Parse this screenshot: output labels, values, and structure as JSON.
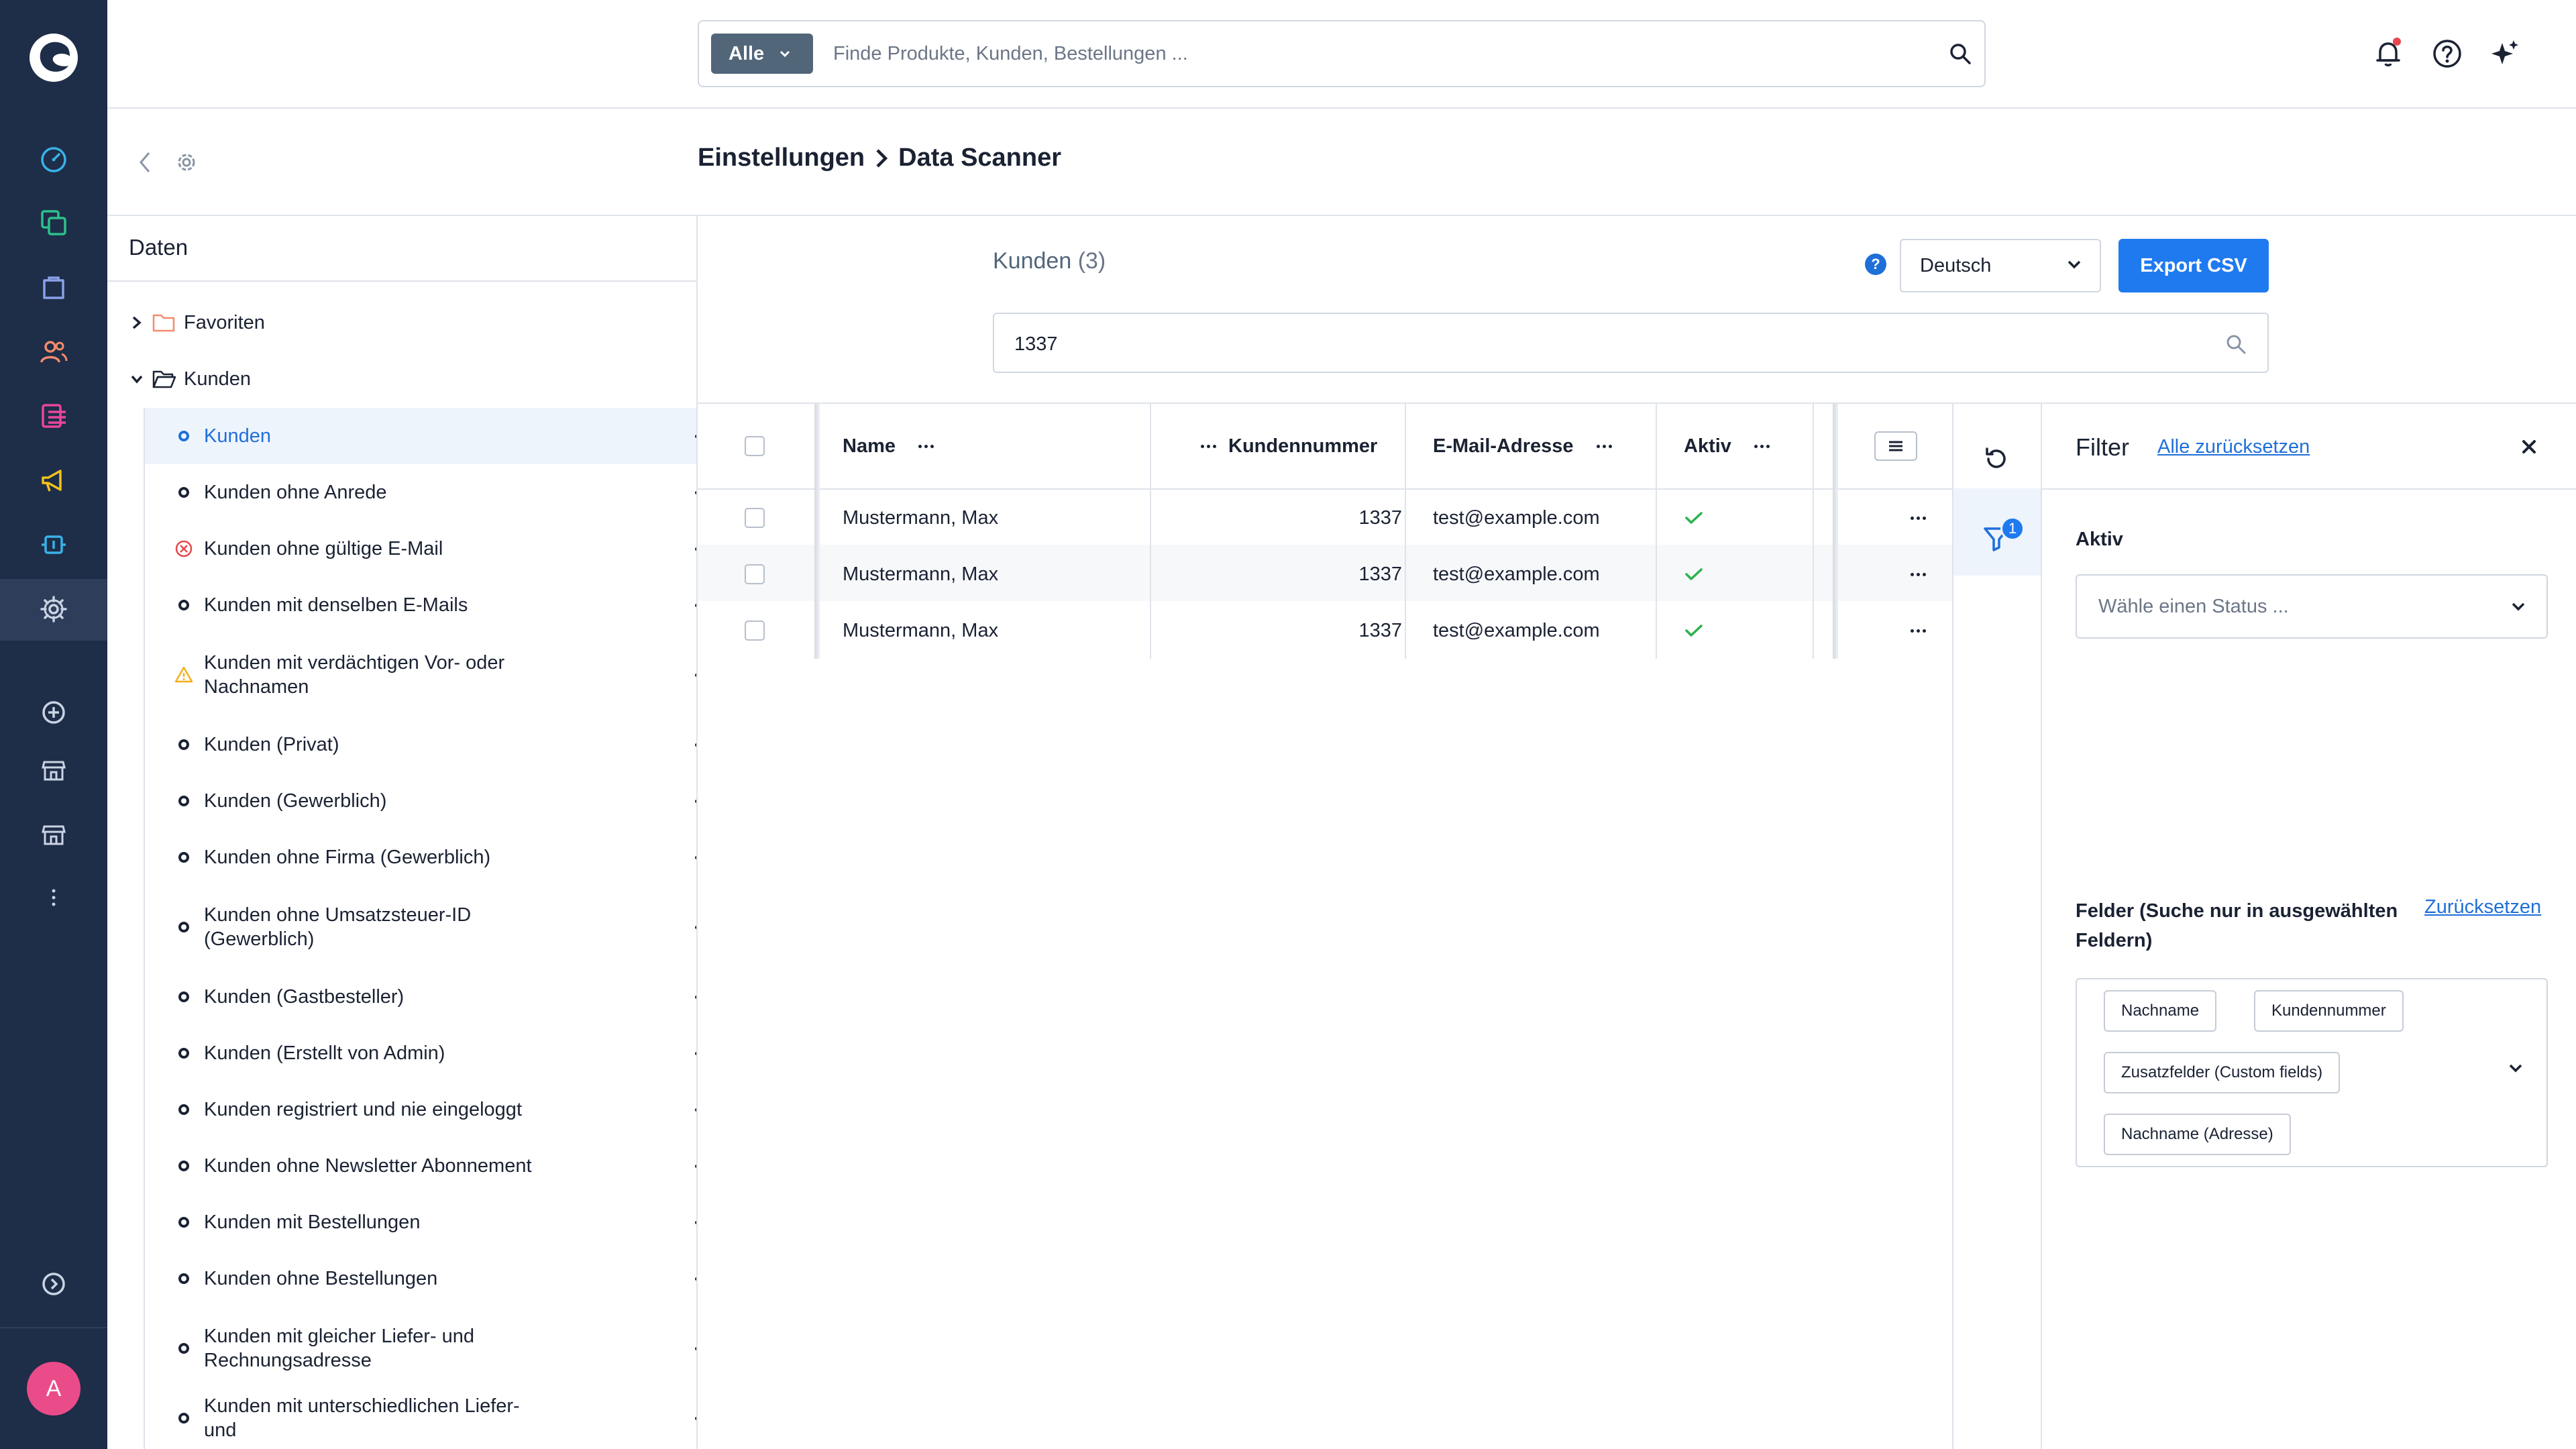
{
  "nav": {
    "avatar_letter": "A",
    "colors": {
      "bg": "#1e2d48",
      "avatar": "#ea4c89"
    },
    "items": [
      {
        "icon": "dashboard-icon"
      },
      {
        "icon": "catalog-icon"
      },
      {
        "icon": "orders-icon"
      },
      {
        "icon": "customers-icon"
      },
      {
        "icon": "content-icon"
      },
      {
        "icon": "marketing-icon"
      },
      {
        "icon": "extensions-icon"
      },
      {
        "icon": "settings-icon"
      },
      {
        "icon": "add-circle-icon"
      },
      {
        "icon": "storefront-icon"
      },
      {
        "icon": "storefront-icon"
      },
      {
        "icon": "more-vertical-icon"
      },
      {
        "icon": "expand-icon"
      }
    ]
  },
  "topbar": {
    "search_scope": "Alle",
    "search_placeholder": "Finde Produkte, Kunden, Bestellungen ..."
  },
  "breadcrumb": {
    "parent": "Einstellungen",
    "current": "Data Scanner"
  },
  "tree": {
    "title": "Daten",
    "folders": [
      {
        "label": "Favoriten",
        "expanded": false
      },
      {
        "label": "Kunden",
        "expanded": true
      }
    ],
    "items": [
      {
        "label": "Kunden",
        "active": true,
        "status": "ok"
      },
      {
        "label": "Kunden ohne Anrede",
        "status": "ok"
      },
      {
        "label": "Kunden ohne gültige E-Mail",
        "status": "error"
      },
      {
        "label": "Kunden mit denselben E-Mails",
        "status": "ok"
      },
      {
        "label": "Kunden mit verdächtigen Vor- oder Nachnamen",
        "status": "warning"
      },
      {
        "label": "Kunden (Privat)",
        "status": "ok"
      },
      {
        "label": "Kunden (Gewerblich)",
        "status": "ok"
      },
      {
        "label": "Kunden ohne Firma (Gewerblich)",
        "status": "ok"
      },
      {
        "label": "Kunden ohne Umsatzsteuer-ID (Gewerblich)",
        "status": "ok"
      },
      {
        "label": "Kunden (Gastbesteller)",
        "status": "ok"
      },
      {
        "label": "Kunden (Erstellt von Admin)",
        "status": "ok"
      },
      {
        "label": "Kunden registriert und nie eingeloggt",
        "status": "ok"
      },
      {
        "label": "Kunden ohne Newsletter Abonnement",
        "status": "ok"
      },
      {
        "label": "Kunden mit Bestellungen",
        "status": "ok"
      },
      {
        "label": "Kunden ohne Bestellungen",
        "status": "ok"
      },
      {
        "label": "Kunden mit gleicher Liefer- und Rechnungsadresse",
        "status": "ok"
      },
      {
        "label": "Kunden mit unterschiedlichen Liefer- und",
        "status": "ok"
      }
    ]
  },
  "main": {
    "entity_title": "Kunden",
    "entity_count": "(3)",
    "help": "?",
    "language": "Deutsch",
    "export_label": "Export CSV",
    "grid_search_value": "1337"
  },
  "table": {
    "columns": [
      "Name",
      "Kundennummer",
      "E-Mail-Adresse",
      "Aktiv"
    ],
    "rows": [
      {
        "name": "Mustermann, Max",
        "number": "1337",
        "email": "test@example.com",
        "active": true
      },
      {
        "name": "Mustermann, Max",
        "number": "1337",
        "email": "test@example.com",
        "active": true
      },
      {
        "name": "Mustermann, Max",
        "number": "1337",
        "email": "test@example.com",
        "active": true
      }
    ]
  },
  "filter": {
    "title": "Filter",
    "reset_all": "Alle zurücksetzen",
    "badge": "1",
    "aktiv_label": "Aktiv",
    "status_placeholder": "Wähle einen Status ...",
    "felder_label": "Felder (Suche nur in ausgewählten Feldern)",
    "felder_reset": "Zurücksetzen",
    "tags": [
      "Nachname",
      "Kundennummer",
      "Zusatzfelder (Custom fields)",
      "Nachname (Adresse)"
    ]
  },
  "colors": {
    "accent": "#1f7af0",
    "link": "#1f6fd9",
    "check": "#2bb24c",
    "error": "#e5484d",
    "warning": "#f2b01e",
    "notify_dot": "#e5484d"
  }
}
